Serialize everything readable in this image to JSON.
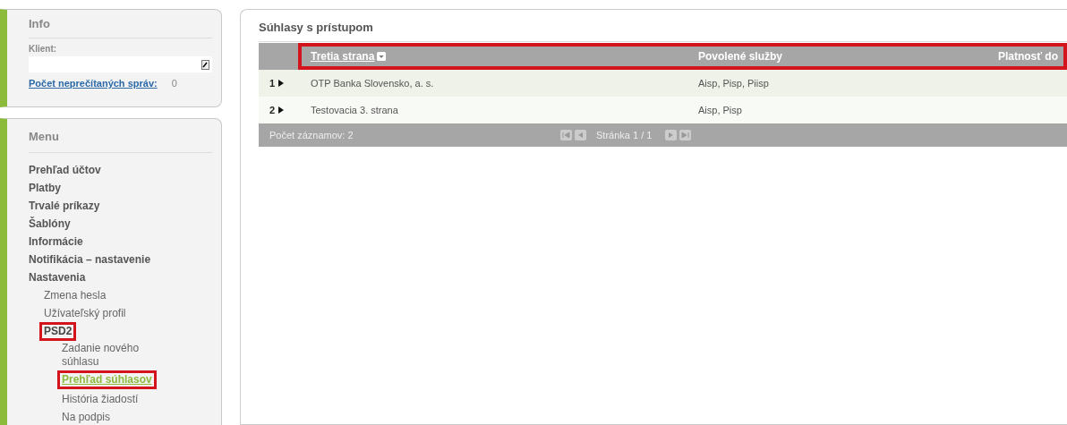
{
  "info": {
    "title": "Info",
    "client_label": "Klient:",
    "unread_link": "Počet neprečítaných správ:",
    "unread_count": "0"
  },
  "menu": {
    "title": "Menu",
    "items": [
      {
        "label": "Prehľad účtov",
        "selected": false,
        "highlighted": false
      },
      {
        "label": "Platby",
        "selected": false,
        "highlighted": false
      },
      {
        "label": "Trvalé príkazy",
        "selected": false,
        "highlighted": false
      },
      {
        "label": "Šablóny",
        "selected": false,
        "highlighted": false
      },
      {
        "label": "Informácie",
        "selected": false,
        "highlighted": false
      },
      {
        "label": "Notifikácia – nastavenie",
        "selected": false,
        "highlighted": false
      },
      {
        "label": "Nastavenia",
        "selected": false,
        "highlighted": false,
        "children": [
          {
            "label": "Zmena hesla",
            "selected": false,
            "highlighted": false
          },
          {
            "label": "Užívateľský profil",
            "selected": false,
            "highlighted": false
          },
          {
            "label": "PSD2",
            "selected": false,
            "highlighted": true,
            "children": [
              {
                "label": "Zadanie nového súhlasu",
                "selected": false,
                "highlighted": false
              },
              {
                "label": "Prehľad súhlasov",
                "selected": true,
                "highlighted": true
              },
              {
                "label": "História žiadostí",
                "selected": false,
                "highlighted": false
              },
              {
                "label": "Na podpis",
                "selected": false,
                "highlighted": false
              }
            ]
          }
        ]
      }
    ]
  },
  "main": {
    "title": "Súhlasy s prístupom",
    "table": {
      "header_highlighted": true,
      "columns": [
        {
          "label": "Tretia strana",
          "sortable": true
        },
        {
          "label": "Povolené služby",
          "sortable": false
        },
        {
          "label": "Platnosť do",
          "sortable": false
        }
      ],
      "rows": [
        {
          "number": "1",
          "cells": [
            "OTP Banka Slovensko, a. s.",
            "Aisp, Pisp, Piisp",
            ""
          ]
        },
        {
          "number": "2",
          "cells": [
            "Testovacia 3. strana",
            "Aisp, Pisp",
            ""
          ]
        }
      ],
      "footer": {
        "count": "Počet záznamov: 2",
        "page": "Stránka 1 / 1"
      }
    }
  }
}
